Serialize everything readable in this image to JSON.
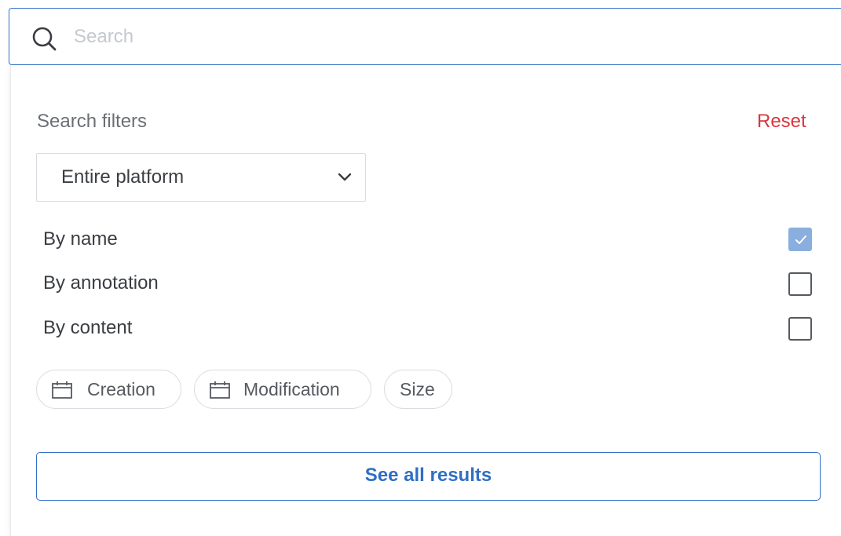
{
  "search": {
    "placeholder": "Search",
    "value": ""
  },
  "filters": {
    "title": "Search filters",
    "reset_label": "Reset",
    "scope": {
      "selected": "Entire platform"
    },
    "options": [
      {
        "label": "By name",
        "checked": true
      },
      {
        "label": "By annotation",
        "checked": false
      },
      {
        "label": "By content",
        "checked": false
      }
    ],
    "chips": [
      {
        "label": "Creation",
        "icon": "calendar-icon"
      },
      {
        "label": "Modification",
        "icon": "calendar-icon"
      },
      {
        "label": "Size",
        "icon": ""
      }
    ],
    "see_all_label": "See all results"
  },
  "colors": {
    "accent": "#2f6fc4",
    "danger": "#d9363e",
    "checked": "#8aaede"
  }
}
